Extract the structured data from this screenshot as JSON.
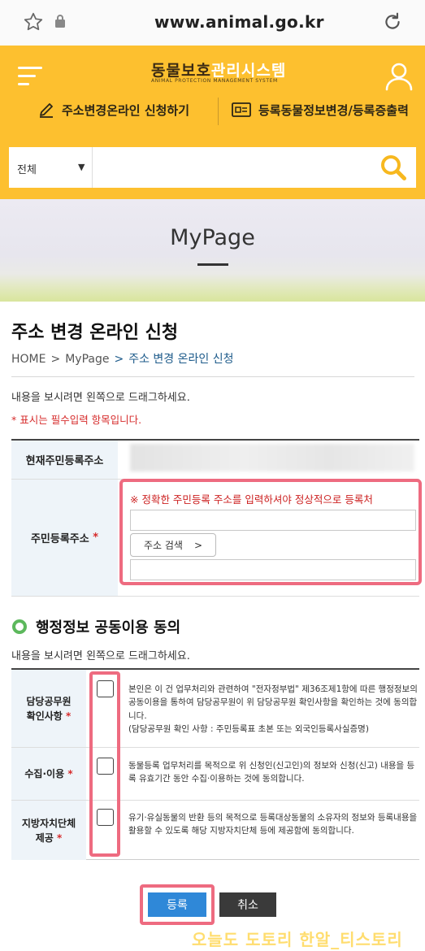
{
  "browser": {
    "url": "www.animal.go.kr"
  },
  "header": {
    "logo_part1": "동물보호",
    "logo_part2": "관리시스템",
    "logo_sub": "ANIMAL PROTECTION MANAGEMENT SYSTEM",
    "quick_links": [
      "주소변경온라인 신청하기",
      "등록동물정보변경/등록증출력"
    ],
    "search": {
      "select_value": "전체",
      "placeholder": ""
    }
  },
  "banner": {
    "title": "MyPage"
  },
  "page": {
    "title": "주소 변경 온라인 신청",
    "breadcrumb": [
      "HOME",
      "MyPage",
      "주소 변경 온라인 신청"
    ],
    "drag_hint": "내용을 보시려면 왼쪽으로 드래그하세요.",
    "required_note": "* 표시는 필수입력 항목입니다."
  },
  "address_form": {
    "current_label": "현재주민등록주소",
    "resident_label": "주민등록주소",
    "required_mark": "*",
    "warning": "※ 정확한 주민등록 주소를 입력하셔야 정상적으로 등록처",
    "search_button": "주소 검색",
    "search_chevron": ">"
  },
  "agreement": {
    "title": "행정정보 공동이용 동의",
    "drag_hint": "내용을 보시려면 왼쪽으로 드래그하세요.",
    "rows": [
      {
        "label_line1": "담당공무원",
        "label_line2": "확인사항",
        "text": "본인은 이 건 업무처리와 관련하여 \"전자정부법\" 제36조제1항에 따른 행정정보의 공동이용을 통하여 담당공무원이 위 담당공무원 확인사항을 확인하는 것에 동의합니다.",
        "text_note": "(담당공무원 확인 사항 : 주민등록표 초본 또는 외국인등록사실증명)"
      },
      {
        "label_line1": "수집·이용",
        "label_line2": "",
        "text": "동물등록 업무처리를 목적으로 위 신청인(신고인)의 정보와 신청(신고) 내용을 등록 유효기간 동안 수집·이용하는 것에 동의합니다.",
        "text_note": ""
      },
      {
        "label_line1": "지방자치단체",
        "label_line2": "제공",
        "text": "유기·유실동물의 반환 등의 목적으로 등록대상동물의 소유자의 정보와 등록내용을 활용할 수 있도록 해당 지방자치단체 등에 제공함에 동의합니다.",
        "text_note": ""
      }
    ]
  },
  "actions": {
    "submit": "등록",
    "cancel": "취소"
  },
  "watermark": "오늘도 도토리 한알_티스토리",
  "colors": {
    "header_yellow": "#fdc02f",
    "highlight_pink": "#ee6b80",
    "submit_blue": "#2f88d8",
    "required_red": "#d62b2b"
  }
}
